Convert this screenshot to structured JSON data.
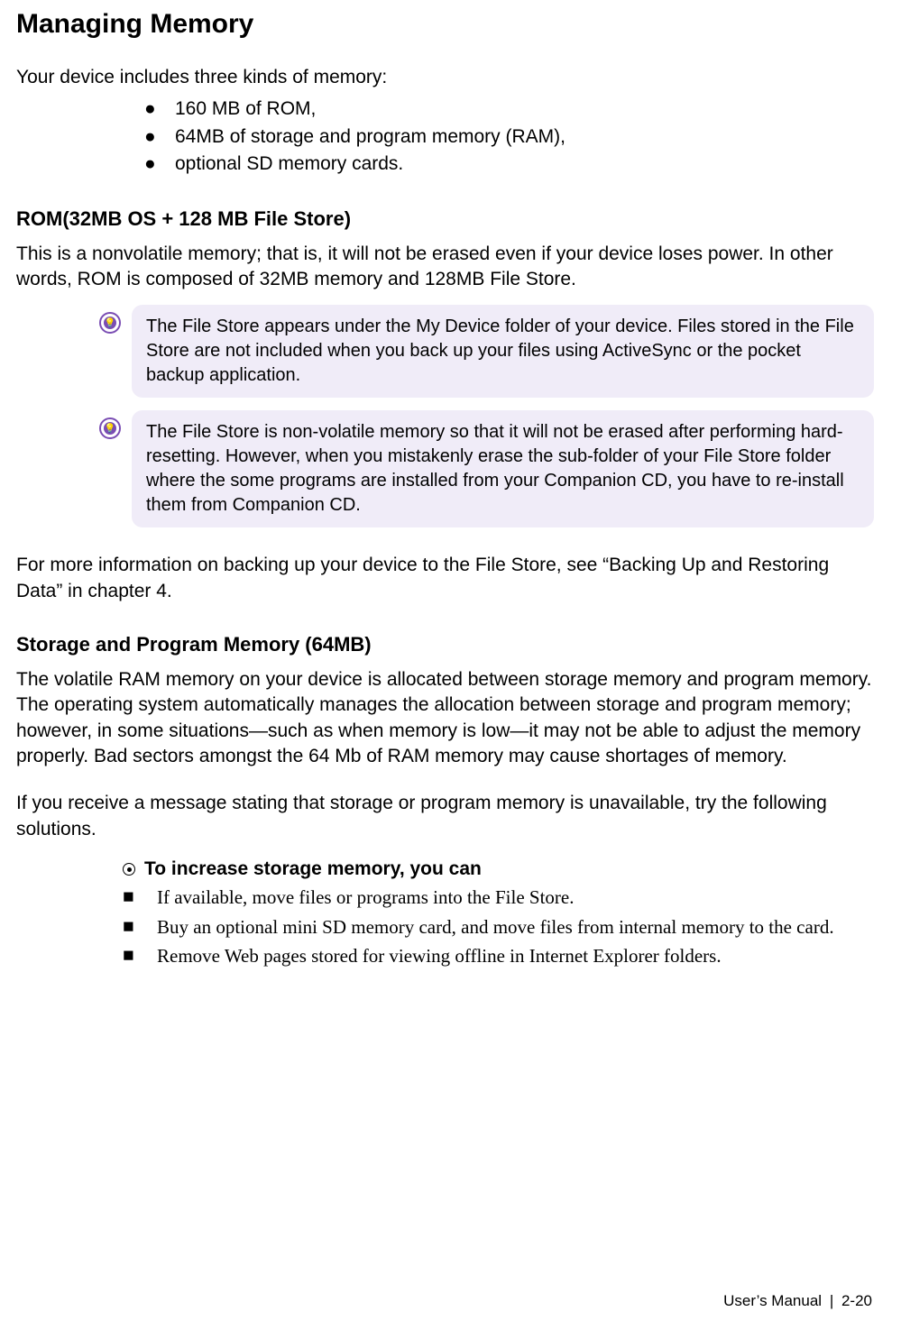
{
  "title": "Managing Memory",
  "intro": "Your device includes three kinds of memory:",
  "mem_bullets": [
    "160 MB of ROM,",
    "64MB of storage and program memory (RAM),",
    "optional SD memory cards."
  ],
  "rom": {
    "heading": "ROM(32MB OS + 128 MB File Store)",
    "para": "This is a nonvolatile memory; that is, it will not be erased even if your device loses power. In other words, ROM is composed of 32MB memory and 128MB File Store.",
    "note1": "The File Store appears under the My Device folder of your device. Files stored in the File Store are not included when you back up your files using ActiveSync or the pocket backup application.",
    "note2": "The File Store is non-volatile memory so that it will not be erased after performing hard-resetting. However, when you mistakenly erase the sub-folder of your File Store folder where the some programs are installed from your Companion CD, you have to re-install them from Companion CD.",
    "after": "For more information on backing up your device to the File Store, see “Backing Up and Restoring Data” in chapter 4."
  },
  "storage": {
    "heading": "Storage and Program Memory (64MB)",
    "para1": "The volatile RAM memory on your device is allocated between storage memory and program memory. The operating system automatically manages the allocation between storage and program memory; however, in some situations—such as when memory is low—it may not be able to adjust the memory properly. Bad sectors amongst the 64 Mb of RAM memory may cause shortages of memory.",
    "para2": "If you receive a message stating that storage or program memory is unavailable, try the following solutions.",
    "lead": "To increase storage memory, you can",
    "storage_bullets": [
      "If available, move files or programs into the File Store.",
      "Buy an optional mini SD memory card, and move files from internal memory to the card.",
      "Remove Web pages stored for viewing offline in Internet Explorer folders."
    ]
  },
  "footer": {
    "label": "User’s Manual",
    "page": "2-20"
  }
}
